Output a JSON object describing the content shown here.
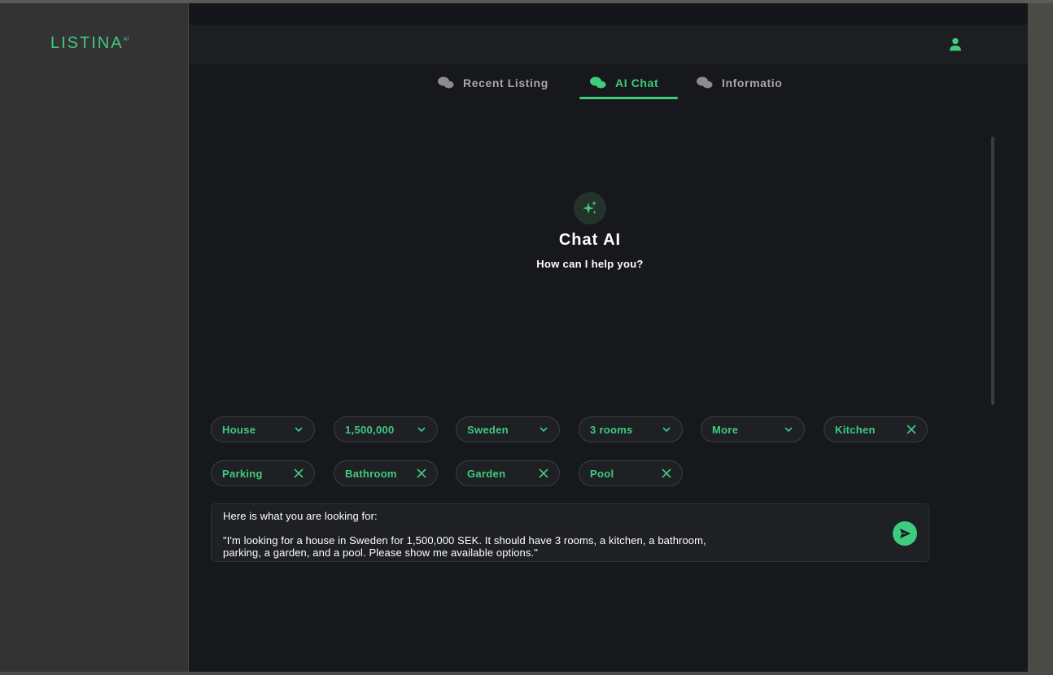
{
  "app": {
    "logo_text": "LISTINA",
    "logo_superscript": "AI"
  },
  "header": {
    "user_icon": "user-icon"
  },
  "tabs": [
    {
      "label": "Recent Listing",
      "icon": "chat-bubbles-icon",
      "active": false
    },
    {
      "label": "AI Chat",
      "icon": "chat-bubbles-icon",
      "active": true
    },
    {
      "label": "Informatio",
      "icon": "chat-bubbles-icon",
      "active": false
    }
  ],
  "hero": {
    "icon": "sparkles-icon",
    "title": "Chat AI",
    "subtitle": "How can I help you?"
  },
  "filters": {
    "dropdowns": [
      {
        "label": "House",
        "icon": "chevron-down-icon"
      },
      {
        "label": "1,500,000",
        "icon": "chevron-down-icon"
      },
      {
        "label": "Sweden",
        "icon": "chevron-down-icon"
      },
      {
        "label": "3 rooms",
        "icon": "chevron-down-icon"
      },
      {
        "label": "More",
        "icon": "chevron-down-icon"
      }
    ],
    "tags": [
      {
        "label": "Kitchen",
        "icon": "close-icon"
      },
      {
        "label": "Parking",
        "icon": "close-icon"
      },
      {
        "label": "Bathroom",
        "icon": "close-icon"
      },
      {
        "label": "Garden",
        "icon": "close-icon"
      },
      {
        "label": "Pool",
        "icon": "close-icon"
      }
    ]
  },
  "composer": {
    "text": "Here is what you are looking for:\n\n\"I'm looking for a house in Sweden for 1,500,000 SEK. It should have 3 rooms, a kitchen, a bathroom,\nparking, a garden, and a pool. Please show me available options.\"",
    "send_icon": "send-icon"
  },
  "colors": {
    "accent": "#3fcb7e",
    "background": "#16181b",
    "sidebar": "#333333"
  }
}
